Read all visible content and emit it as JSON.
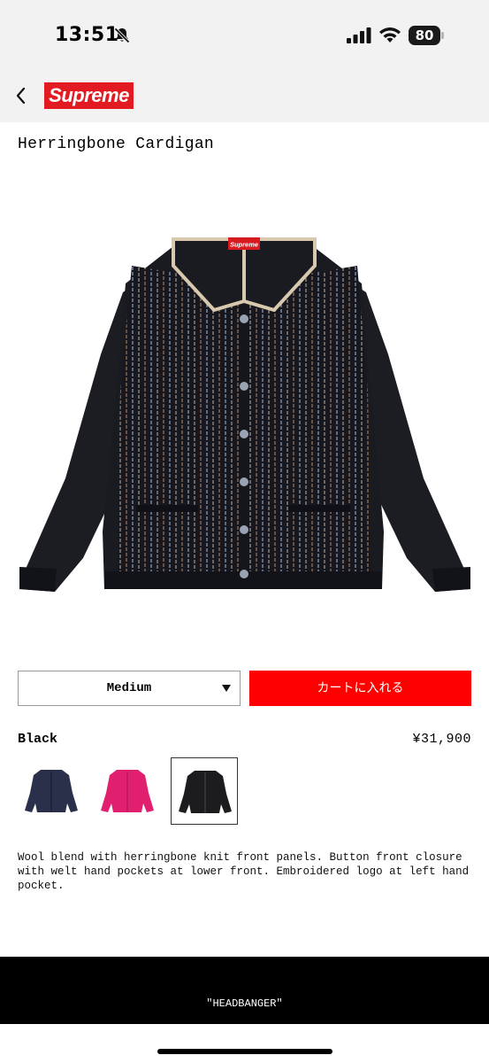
{
  "status_bar": {
    "time": "13:51",
    "battery_level": "80",
    "icons": [
      "bell-slash-icon",
      "cellular-signal-icon",
      "wifi-icon",
      "battery-icon"
    ]
  },
  "header": {
    "back_icon": "chevron-left-icon",
    "logo_text": "Supreme",
    "logo_color": "#e21b23"
  },
  "product": {
    "title": "Herringbone Cardigan",
    "image_label": "Supreme",
    "size_selected": "Medium",
    "add_to_cart_label": "カートに入れる",
    "add_to_cart_color": "#ff0000",
    "color_name": "Black",
    "price": "¥31,900",
    "swatches": [
      {
        "color": "navy",
        "hex": "#2a2f4a",
        "selected": false
      },
      {
        "color": "pink",
        "hex": "#e0206e",
        "selected": false
      },
      {
        "color": "black",
        "hex": "#1c1c1e",
        "selected": true
      }
    ],
    "description": "Wool blend with herringbone knit front panels. Button front closure with welt hand pockets at lower front. Embroidered logo at left hand pocket."
  },
  "footer": {
    "text": "\"HEADBANGER\""
  }
}
